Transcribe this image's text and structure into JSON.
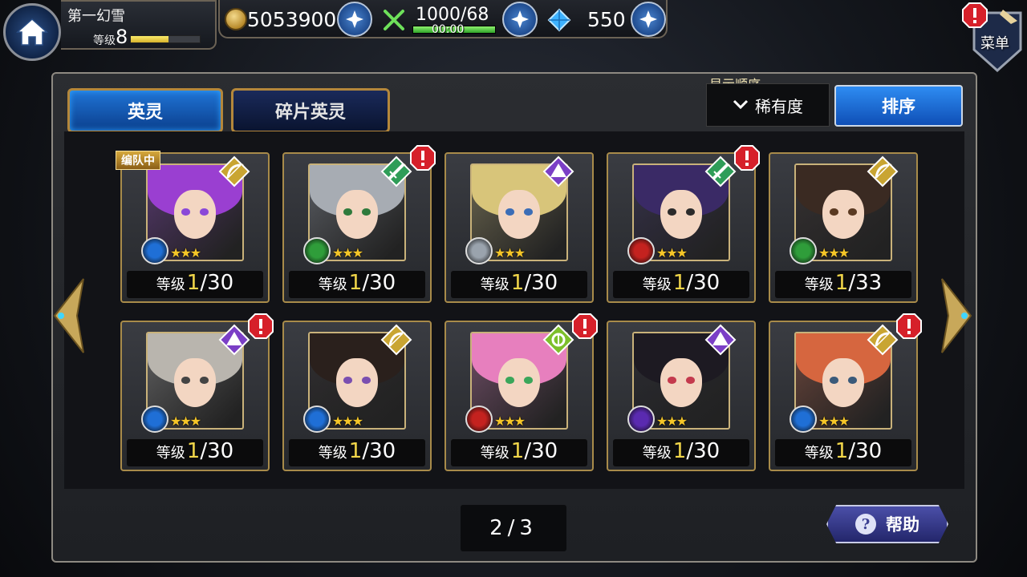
{
  "player": {
    "name": "第一幻雪",
    "level_label": "等级",
    "level": "8",
    "exp_ratio": 0.55
  },
  "resources": {
    "coins": "5053900",
    "stamina": "1000/68",
    "stamina_timer": "00:00",
    "stamina_ratio": 1.0,
    "gems": "550"
  },
  "menu": {
    "label": "菜单"
  },
  "tabs": [
    {
      "label": "英灵"
    },
    {
      "label": "碎片英灵"
    }
  ],
  "sort": {
    "caption": "显示顺序",
    "selected": "稀有度",
    "button_label": "排序"
  },
  "in_team_label": "编队中",
  "level_label": "等级",
  "cards": [
    {
      "level": "1",
      "max": "/30",
      "class": "bow",
      "element": "water",
      "alert": false,
      "in_team": true,
      "hair": "#9a3fd1",
      "eye": "#8a48d8"
    },
    {
      "level": "1",
      "max": "/30",
      "class": "sword",
      "element": "wind",
      "alert": true,
      "in_team": false,
      "hair": "#a7acb3",
      "eye": "#2f7a3c"
    },
    {
      "level": "1",
      "max": "/30",
      "class": "mage",
      "element": "light",
      "alert": false,
      "in_team": false,
      "hair": "#d8c57a",
      "eye": "#3b6db6"
    },
    {
      "level": "1",
      "max": "/30",
      "class": "sword",
      "element": "fire",
      "alert": true,
      "in_team": false,
      "hair": "#3a2a66",
      "eye": "#2b2b2b"
    },
    {
      "level": "1",
      "max": "/33",
      "class": "bow",
      "element": "wind",
      "alert": false,
      "in_team": false,
      "hair": "#3a2a22",
      "eye": "#5a3a22"
    },
    {
      "level": "1",
      "max": "/30",
      "class": "mage",
      "element": "water",
      "alert": true,
      "in_team": false,
      "hair": "#b9b5ae",
      "eye": "#444"
    },
    {
      "level": "1",
      "max": "/30",
      "class": "bow",
      "element": "water",
      "alert": false,
      "in_team": false,
      "hair": "#2a201c",
      "eye": "#7a4fb0"
    },
    {
      "level": "1",
      "max": "/30",
      "class": "healer",
      "element": "fire",
      "alert": true,
      "in_team": false,
      "hair": "#e77fbe",
      "eye": "#3aa65a"
    },
    {
      "level": "1",
      "max": "/30",
      "class": "mage",
      "element": "dark",
      "alert": false,
      "in_team": false,
      "hair": "#1d1a22",
      "eye": "#c43a4d"
    },
    {
      "level": "1",
      "max": "/30",
      "class": "bow",
      "element": "water",
      "alert": true,
      "in_team": false,
      "hair": "#d6663f",
      "eye": "#3a5a7a"
    }
  ],
  "pagination": {
    "current": "2",
    "separator": "/",
    "total": "3"
  },
  "help": {
    "label": "帮助"
  },
  "colors": {
    "accent_blue": "#1f74d6",
    "gold_border": "#a88b4a",
    "level_yellow": "#f1d64a",
    "alert_red": "#d6202a"
  }
}
